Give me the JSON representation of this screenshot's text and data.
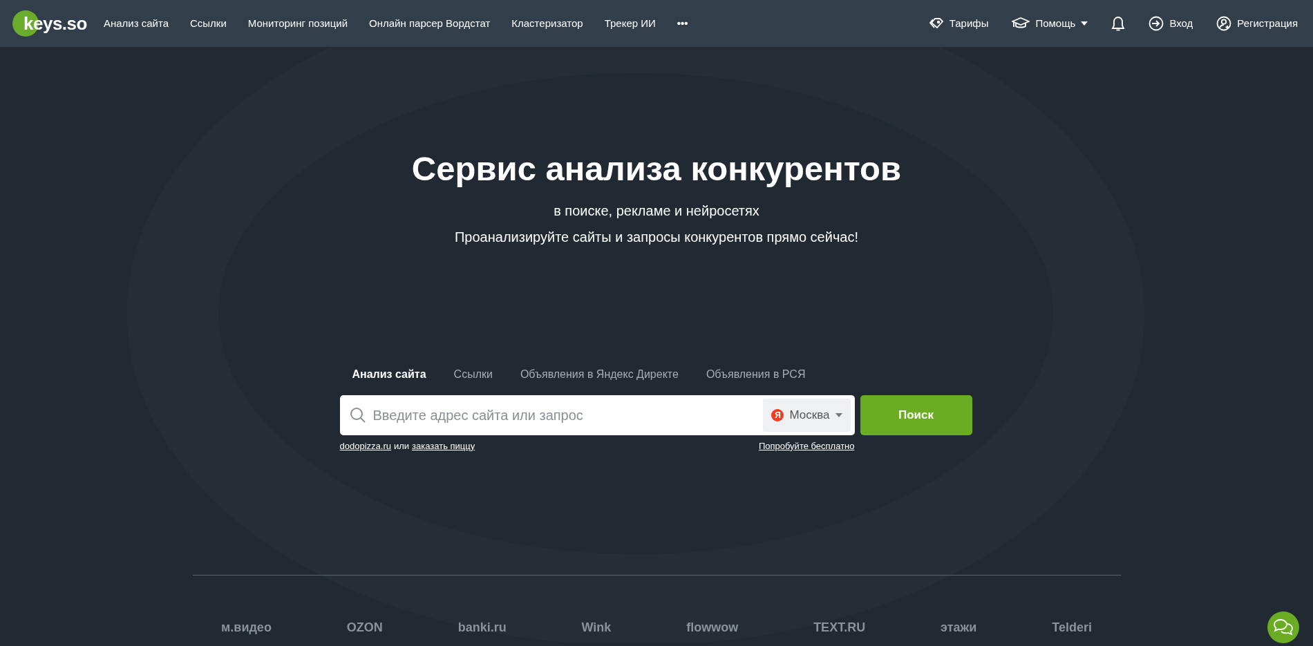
{
  "navbar": {
    "logo": "keys.so",
    "items": [
      "Анализ сайта",
      "Ссылки",
      "Мониторинг позиций",
      "Онлайн парсер Вордстат",
      "Кластеризатор",
      "Трекер ИИ"
    ],
    "more": "•••",
    "right": [
      {
        "kind": "tag",
        "label": "Тарифы"
      },
      {
        "kind": "cap",
        "label": "Помощь",
        "dropdown": true
      },
      {
        "kind": "bell"
      },
      {
        "kind": "login",
        "label": "Вход"
      },
      {
        "kind": "user",
        "label": "Регистрация"
      }
    ]
  },
  "hero": {
    "title": "Сервис анализа конкурентов",
    "subtitle": "в поиске, рекламе и нейросетях",
    "tagline": "Проанализируйте сайты и запросы конкурентов прямо сейчас!"
  },
  "search": {
    "tabs": [
      {
        "label": "Анализ сайта",
        "selected": true
      },
      {
        "label": "Ссылки",
        "selected": false
      },
      {
        "label": "Объявления в Яндекс Директе",
        "selected": false
      },
      {
        "label": "Объявления в РСЯ",
        "selected": false
      }
    ],
    "placeholder": "Введите адрес сайта или запрос",
    "region_badge": "Я",
    "region": "Москва",
    "button": "Поиск",
    "example_link": "dodopizza.ru",
    "example_or": "или",
    "example_link_2": "заказать пиццу",
    "trial_link": "Попробуйте бесплатно"
  },
  "clients": [
    "м.видео",
    "OZON",
    "banki.ru",
    "Wink",
    "flowwow",
    "TEXT.RU",
    "этажи",
    "Telderi"
  ]
}
